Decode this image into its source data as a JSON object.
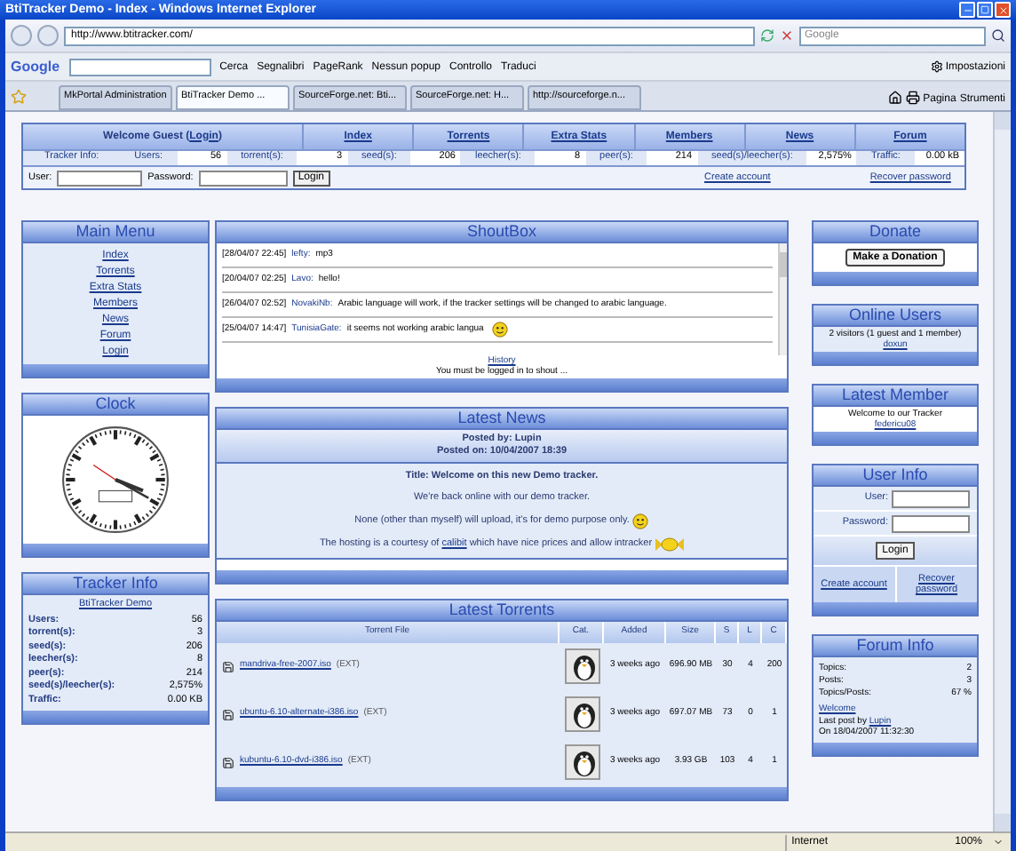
{
  "window": {
    "title": "BtiTracker Demo - Index - Windows Internet Explorer"
  },
  "address_bar": {
    "url": "http://www.btitracker.com/"
  },
  "search": {
    "placeholder": "Google"
  },
  "google_toolbar": {
    "logo": "Google",
    "search_button": "Cerca",
    "items": [
      "Segnalibri",
      "PageRank",
      "Nessun popup",
      "Controllo",
      "Traduci"
    ],
    "settings": "Impostazioni"
  },
  "tabs": [
    {
      "label": "MkPortal Administration",
      "selected": false
    },
    {
      "label": "BtiTracker Demo ...",
      "selected": true
    },
    {
      "label": "SourceForge.net: Bti...",
      "selected": false
    },
    {
      "label": "SourceForge.net: H...",
      "selected": false
    },
    {
      "label": "http://sourceforge.n...",
      "selected": false
    }
  ],
  "command_bar": [
    "Pagina",
    "Strumenti"
  ],
  "site_nav": {
    "welcome": "Welcome Guest (",
    "login_link": "Login",
    "welcome_end": ")",
    "links": [
      "Index",
      "Torrents",
      "Extra Stats",
      "Members",
      "News",
      "Forum"
    ]
  },
  "tracker_bar": {
    "title": "Tracker Info:",
    "stats": [
      {
        "label": "Users:",
        "value": "56"
      },
      {
        "label": "torrent(s):",
        "value": "3"
      },
      {
        "label": "seed(s):",
        "value": "206"
      },
      {
        "label": "leecher(s):",
        "value": "8"
      },
      {
        "label": "peer(s):",
        "value": "214"
      },
      {
        "label": "seed(s)/leecher(s):",
        "value": "2,575%"
      },
      {
        "label": "Traffic:",
        "value": "0.00 kB"
      }
    ]
  },
  "login_bar": {
    "user_label": "User:",
    "password_label": "Password:",
    "button": "Login",
    "links": [
      "Create account",
      "Recover password"
    ]
  },
  "main_menu": {
    "title": "Main Menu",
    "items": [
      "Index",
      "Torrents",
      "Extra Stats",
      "Members",
      "News",
      "Forum",
      "Login"
    ]
  },
  "clock": {
    "title": "Clock"
  },
  "tracker_info": {
    "title": "Tracker Info",
    "name": "BtiTracker Demo",
    "rows": [
      {
        "label": "Users:",
        "value": "56"
      },
      {
        "label": "torrent(s):",
        "value": "3"
      },
      {
        "label": "seed(s):",
        "value": "206"
      },
      {
        "label": "leecher(s):",
        "value": "8"
      },
      {
        "label": "peer(s):",
        "value": "214"
      },
      {
        "label": "seed(s)/leecher(s):",
        "value": "2,575%"
      },
      {
        "label": "Traffic:",
        "value": "0.00 KB"
      }
    ]
  },
  "shoutbox": {
    "title": "ShoutBox",
    "messages": [
      {
        "time": "[28/04/07 22:45]",
        "user": "lefty:",
        "text": "mp3",
        "emoticon": false
      },
      {
        "time": "[20/04/07 02:25]",
        "user": "Lavo:",
        "text": "hello!",
        "emoticon": false
      },
      {
        "time": "[26/04/07 02:52]",
        "user": "NovakiNb:",
        "text": "Arabic language will work, if the tracker settings will be changed to arabic language.",
        "emoticon": false
      },
      {
        "time": "[25/04/07 14:47]",
        "user": "TunisiaGate:",
        "text": "it seems not working arabic langua",
        "emoticon": true
      }
    ],
    "history": "History",
    "notice": "You must be logged in to shout ..."
  },
  "latest_news": {
    "title": "Latest News",
    "posted_by": "Posted by: Lupin",
    "posted_on": "Posted on: 10/04/2007 18:39",
    "headline": "Title: Welcome on this new Demo tracker.",
    "paragraphs": [
      {
        "text": "We're back online with our demo tracker.",
        "kind": "plain"
      },
      {
        "text": "None (other than myself) will upload, it's for demo purpose only.",
        "kind": "smiley"
      },
      {
        "text": "The hosting is a courtesy of",
        "link": "calibit",
        "after": "which have nice prices and allow intracker",
        "kind": "candy"
      }
    ]
  },
  "latest_torrents": {
    "title": "Latest Torrents",
    "columns": [
      "Torrent File",
      "Cat.",
      "Added",
      "Size",
      "S",
      "L",
      "C"
    ],
    "rows": [
      {
        "name": "mandriva-free-2007.iso",
        "tag": "(EXT)",
        "added": "3 weeks ago",
        "size": "696.90 MB",
        "s": "30",
        "l": "4",
        "c": "200"
      },
      {
        "name": "ubuntu-6.10-alternate-i386.iso",
        "tag": "(EXT)",
        "added": "3 weeks ago",
        "size": "697.07 MB",
        "s": "73",
        "l": "0",
        "c": "1"
      },
      {
        "name": "kubuntu-6.10-dvd-i386.iso",
        "tag": "(EXT)",
        "added": "3 weeks ago",
        "size": "3.93 GB",
        "s": "103",
        "l": "4",
        "c": "1"
      }
    ]
  },
  "donate": {
    "title": "Donate",
    "button": "Make a Donation"
  },
  "online_users": {
    "title": "Online Users",
    "text": "2 visitors (1 guest and 1 member)",
    "user": "doxun"
  },
  "latest_member": {
    "title": "Latest Member",
    "text": "Welcome to our Tracker",
    "name": "federicu08"
  },
  "user_info": {
    "title": "User Info",
    "user_label": "User:",
    "password_label": "Password:",
    "button": "Login",
    "links": [
      "Create account",
      "Recover password"
    ]
  },
  "forum_info": {
    "title": "Forum Info",
    "rows": [
      {
        "label": "Topics:",
        "value": "2"
      },
      {
        "label": "Posts:",
        "value": "3"
      },
      {
        "label": "Topics/Posts:",
        "value": "67 %"
      }
    ],
    "last_topic": "Welcome",
    "last_post_label": "Last post by",
    "last_user": "Lupin",
    "last_date": "On 18/04/2007 11:32:30"
  },
  "status_bar": {
    "zone": "Internet",
    "zoom": "100%"
  }
}
